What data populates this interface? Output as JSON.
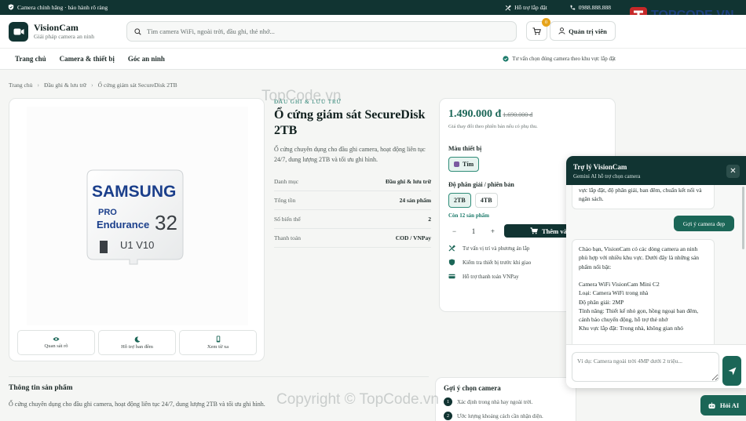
{
  "topbar": {
    "left_text": "Camera chính hãng · bảo hành rõ ràng",
    "support": "Hỗ trợ lắp đặt",
    "phone": "0988.888.888"
  },
  "watermark_logo": "TOPCODE.VN",
  "watermark_texts": [
    "TopCode.vn",
    "Copyright © TopCode.vn"
  ],
  "header": {
    "brand_name": "VisionCam",
    "brand_tagline": "Giải pháp camera an ninh",
    "search_placeholder": "Tìm camera WiFi, ngoài trời, đầu ghi, thẻ nhớ...",
    "cart_count": "0",
    "admin_label": "Quản trị viên"
  },
  "nav": {
    "items": [
      "Trang chủ",
      "Camera & thiết bị",
      "Góc an ninh"
    ],
    "note": "Tư vấn chọn đúng camera theo khu vực lắp đặt"
  },
  "breadcrumb": [
    "Trang chủ",
    "Đầu ghi & lưu trữ",
    "Ổ cứng giám sát SecureDisk 2TB"
  ],
  "product": {
    "image_label": "SAMSUNG",
    "image_line1": "PRO",
    "image_line2": "Endurance",
    "image_capacity": "32",
    "image_marks": "U1 V10",
    "thumbs": [
      "Quan sát rõ",
      "Hỗ trợ ban đêm",
      "Xem từ xa"
    ],
    "category": "ĐẦU GHI & LƯU TRỮ",
    "title": "Ổ cứng giám sát SecureDisk 2TB",
    "description": "Ổ cứng chuyên dụng cho đầu ghi camera, hoạt động liên tục 24/7, dung lượng 2TB và tối ưu ghi hình.",
    "specs": [
      {
        "k": "Danh mục",
        "v": "Đầu ghi & lưu trữ"
      },
      {
        "k": "Tổng tồn",
        "v": "24 sản phẩm"
      },
      {
        "k": "Số biến thể",
        "v": "2"
      },
      {
        "k": "Thanh toán",
        "v": "COD / VNPay"
      }
    ]
  },
  "buybox": {
    "price": "1.490.000 đ",
    "old_price": "1.690.000 đ",
    "price_note": "Giá thay đổi theo phiên bản nếu có phụ thu.",
    "color_label": "Màu thiết bị",
    "color_option": "Tím",
    "color_hex": "#7b5aa1",
    "variant_label": "Độ phân giải / phiên bản",
    "variants": [
      "2TB",
      "4TB"
    ],
    "stock": "Còn 12 sản phẩm",
    "qty": "1",
    "add_label": "Thêm vào giỏ",
    "features": [
      "Tư vấn vị trí và phương án lắp",
      "Kiểm tra thiết bị trước khi giao",
      "Hỗ trợ thanh toán VNPay"
    ]
  },
  "lower": {
    "info_title": "Thông tin sản phẩm",
    "info_body": "Ổ cứng chuyên dụng cho đầu ghi camera, hoạt động liên tục 24/7, dung lượng 2TB và tối ưu ghi hình.",
    "suggest_title": "Gợi ý chọn camera",
    "suggest_items": [
      "Xác định trong nhà hay ngoài trời.",
      "Ước lượng khoảng cách cần nhận diện."
    ]
  },
  "chat": {
    "title": "Trợ lý VisionCam",
    "subtitle": "Gemini AI hỗ trợ chọn camera",
    "msg_top": "vực lắp đặt, độ phân giải, ban đêm, chuẩn kết nối và ngân sách.",
    "user_msg": "Gợi ý camera đẹp",
    "bot_reply": "Chào bạn, VisionCam có các dòng camera an ninh phù hợp với nhiều khu vực. Dưới đây là những sản phẩm nổi bật:\n\nCamera WiFi VisionCam Mini C2\nLoại: Camera WiFi trong nhà\nĐộ phân giải: 2MP\nTính năng: Thiết kế nhỏ gọn, hồng ngoại ban đêm, cảnh báo chuyển động, hỗ trợ thẻ nhớ\nKhu vực lắp đặt: Trong nhà, không gian nhỏ",
    "input_placeholder": "Ví dụ: Camera ngoài trời 4MP dưới 2 triệu...",
    "fab_label": "Hỏi AI"
  }
}
